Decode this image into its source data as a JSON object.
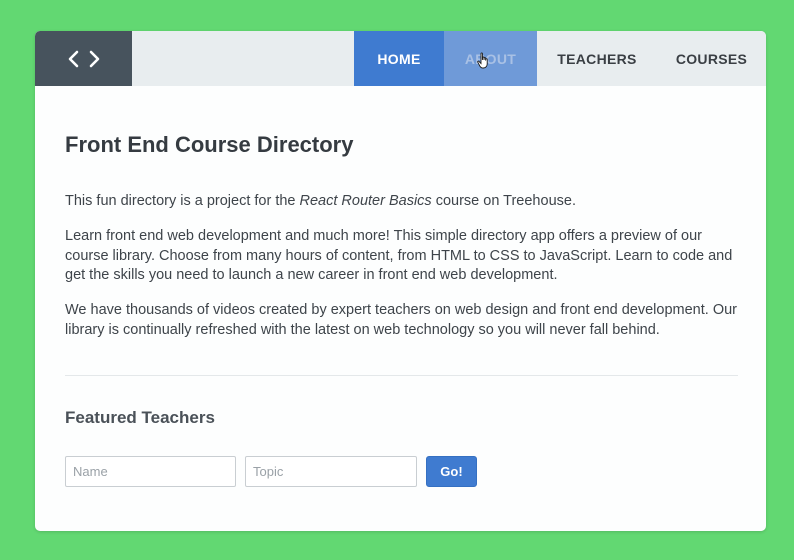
{
  "colors": {
    "background": "#62d872",
    "logo_bg": "#47535d",
    "nav_active": "#3f7bd0",
    "nav_hover": "#6f9ad8",
    "nav_bar": "#e8edef"
  },
  "header": {
    "logo_icon": "code-brackets-icon",
    "nav": [
      {
        "label": "HOME",
        "state": "active"
      },
      {
        "label": "ABOUT",
        "state": "hover"
      },
      {
        "label": "TEACHERS",
        "state": "normal"
      },
      {
        "label": "COURSES",
        "state": "normal"
      }
    ]
  },
  "main": {
    "title": "Front End Course Directory",
    "intro_before": "This fun directory is a project for the ",
    "intro_em": "React Router Basics",
    "intro_after": " course on Treehouse.",
    "para2": "Learn front end web development and much more! This simple directory app offers a preview of our course library. Choose from many hours of content, from HTML to CSS to JavaScript. Learn to code and get the skills you need to launch a new career in front end web development.",
    "para3": "We have thousands of videos created by expert teachers on web design and front end development. Our library is continually refreshed with the latest on web technology so you will never fall behind.",
    "featured_heading": "Featured Teachers"
  },
  "form": {
    "name_placeholder": "Name",
    "topic_placeholder": "Topic",
    "submit_label": "Go!"
  }
}
